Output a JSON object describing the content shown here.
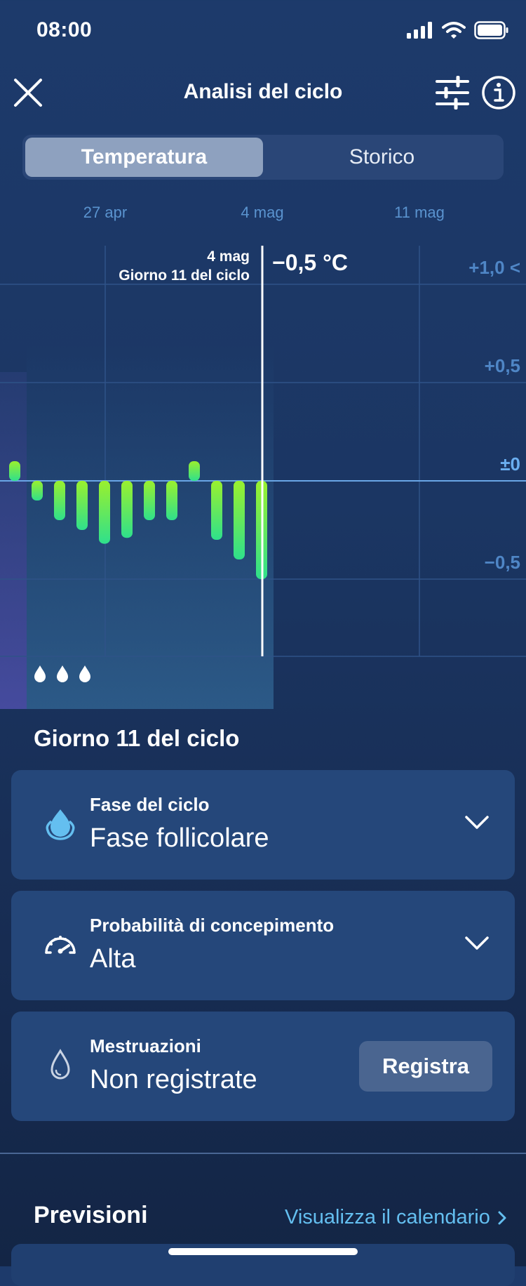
{
  "status_bar": {
    "time": "08:00"
  },
  "header": {
    "title": "Analisi del ciclo"
  },
  "tabs": [
    {
      "label": "Temperatura",
      "selected": true
    },
    {
      "label": "Storico",
      "selected": false
    }
  ],
  "chart_data": {
    "type": "bar",
    "x_tick_labels": [
      "27 apr",
      "4 mag",
      "11 mag"
    ],
    "y_tick_labels": [
      "+1,0 <",
      "+0,5",
      "±0",
      "−0,5"
    ],
    "ylim": [
      -0.9,
      1.1
    ],
    "unit": "°C",
    "selected": {
      "date": "4 mag",
      "cycle_day": "Giorno 11 del ciclo",
      "value_label": "−0,5 °C"
    },
    "days": [
      0,
      1,
      2,
      3,
      4,
      5,
      6,
      7,
      8,
      9,
      10,
      11
    ],
    "values": [
      0.1,
      -0.1,
      -0.2,
      -0.25,
      -0.32,
      -0.29,
      -0.2,
      -0.2,
      0.1,
      -0.3,
      -0.4,
      -0.5
    ],
    "period_days": [
      1,
      2,
      3
    ],
    "colors": {
      "bar_top": "#9af02e",
      "bar_bottom": "#2fe08c",
      "axis_label": "#5a93cf",
      "zero_line": "#6aa6e6"
    }
  },
  "day_section": {
    "title": "Giorno 11 del ciclo",
    "cards": [
      {
        "label": "Fase del ciclo",
        "value": "Fase follicolare",
        "icon": "drop-filled-icon"
      },
      {
        "label": "Probabilità di concepimento",
        "value": "Alta",
        "icon": "speedometer-icon"
      },
      {
        "label": "Mestruazioni",
        "value": "Non registrate",
        "icon": "drop-outline-icon",
        "button": "Registra"
      }
    ]
  },
  "forecast": {
    "title": "Previsioni",
    "link": "Visualizza il calendario"
  }
}
